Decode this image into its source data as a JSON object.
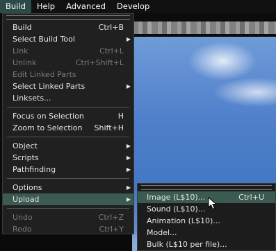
{
  "menubar": [
    "Build",
    "Help",
    "Advanced",
    "Develop"
  ],
  "build_menu": {
    "items": [
      {
        "label": "Build",
        "shortcut": "Ctrl+B"
      },
      {
        "label": "Select Build Tool",
        "arrow": true
      },
      {
        "label": "Link",
        "shortcut": "Ctrl+L",
        "disabled": true
      },
      {
        "label": "Unlink",
        "shortcut": "Ctrl+Shift+L",
        "disabled": true
      },
      {
        "label": "Edit Linked Parts",
        "disabled": true
      },
      {
        "label": "Select Linked Parts",
        "arrow": true
      },
      {
        "label": "Linksets..."
      },
      {
        "sep": true
      },
      {
        "label": "Focus on Selection",
        "shortcut": "H"
      },
      {
        "label": "Zoom to Selection",
        "shortcut": "Shift+H"
      },
      {
        "sep": true
      },
      {
        "label": "Object",
        "arrow": true
      },
      {
        "label": "Scripts",
        "arrow": true
      },
      {
        "label": "Pathfinding",
        "arrow": true
      },
      {
        "sep": true
      },
      {
        "label": "Options",
        "arrow": true
      },
      {
        "label": "Upload",
        "arrow": true,
        "highlighted": true
      },
      {
        "sep": true
      },
      {
        "label": "Undo",
        "shortcut": "Ctrl+Z",
        "disabled": true
      },
      {
        "label": "Redo",
        "shortcut": "Ctrl+Y",
        "disabled": true
      }
    ]
  },
  "upload_menu": {
    "items": [
      {
        "label": "Image (L$10)...",
        "shortcut": "Ctrl+U",
        "highlighted": true
      },
      {
        "label": "Sound (L$10)..."
      },
      {
        "label": "Animation (L$10)..."
      },
      {
        "label": "Model..."
      },
      {
        "label": "Bulk (L$10 per file)..."
      }
    ]
  },
  "colors": {
    "highlight": "#3b5a52",
    "active_menu": "#2c4a47",
    "disabled_text": "#7a7a7a"
  },
  "icons": {
    "submenu_arrow": "triangle-right-icon",
    "cursor": "mouse-pointer-icon"
  }
}
